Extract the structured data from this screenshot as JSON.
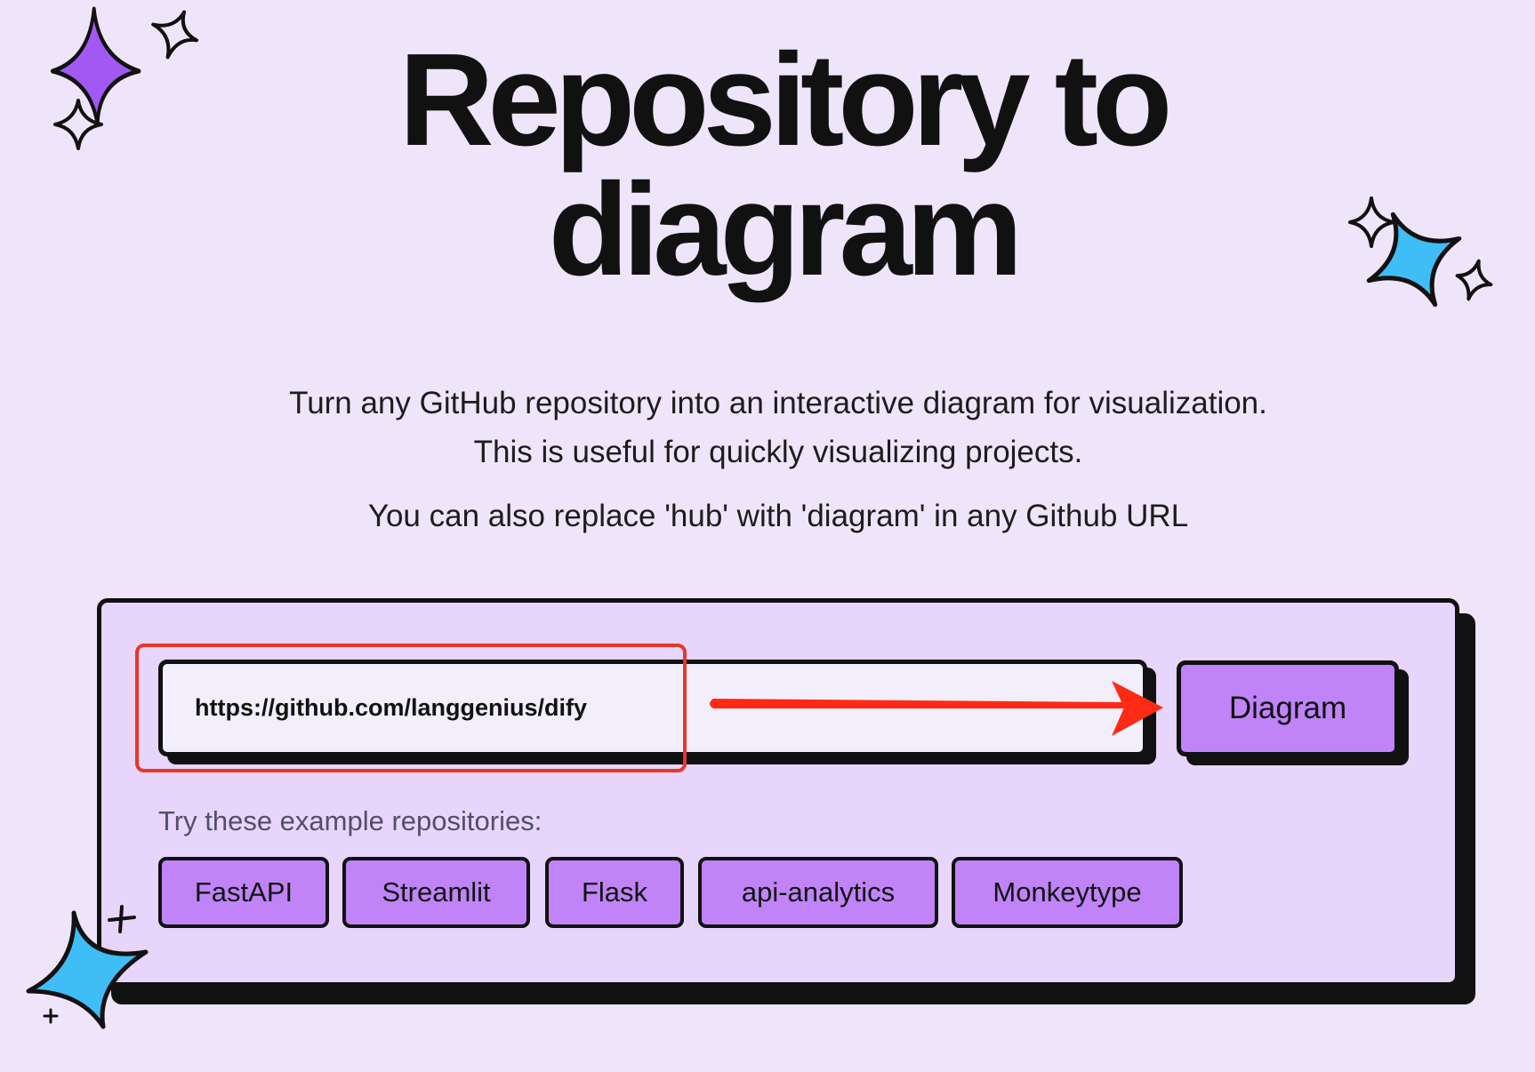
{
  "hero": {
    "title_line1": "Repository to",
    "title_line2": "diagram"
  },
  "description": {
    "line1": "Turn any GitHub repository into an interactive diagram for visualization.",
    "line2": "This is useful for quickly visualizing projects.",
    "line3": "You can also replace 'hub' with 'diagram' in any Github URL"
  },
  "form": {
    "url_value": "https://github.com/langgenius/dify",
    "submit_label": "Diagram"
  },
  "examples": {
    "label": "Try these example repositories:",
    "items": [
      {
        "label": "FastAPI"
      },
      {
        "label": "Streamlit"
      },
      {
        "label": "Flask"
      },
      {
        "label": "api-analytics"
      },
      {
        "label": "Monkeytype"
      }
    ]
  },
  "colors": {
    "background": "#efe5fb",
    "card": "#e7d5fb",
    "button_purple": "#c083f8",
    "sparkle_purple": "#a259f4",
    "sparkle_blue": "#3fbdf5",
    "annotation_red": "#e8372a"
  },
  "icons": {
    "sparkles": [
      "sparkle-purple-icon",
      "sparkle-blue-icon",
      "sparkle-outline-icon",
      "plus-icon"
    ],
    "annotation": "red-arrow-icon"
  }
}
